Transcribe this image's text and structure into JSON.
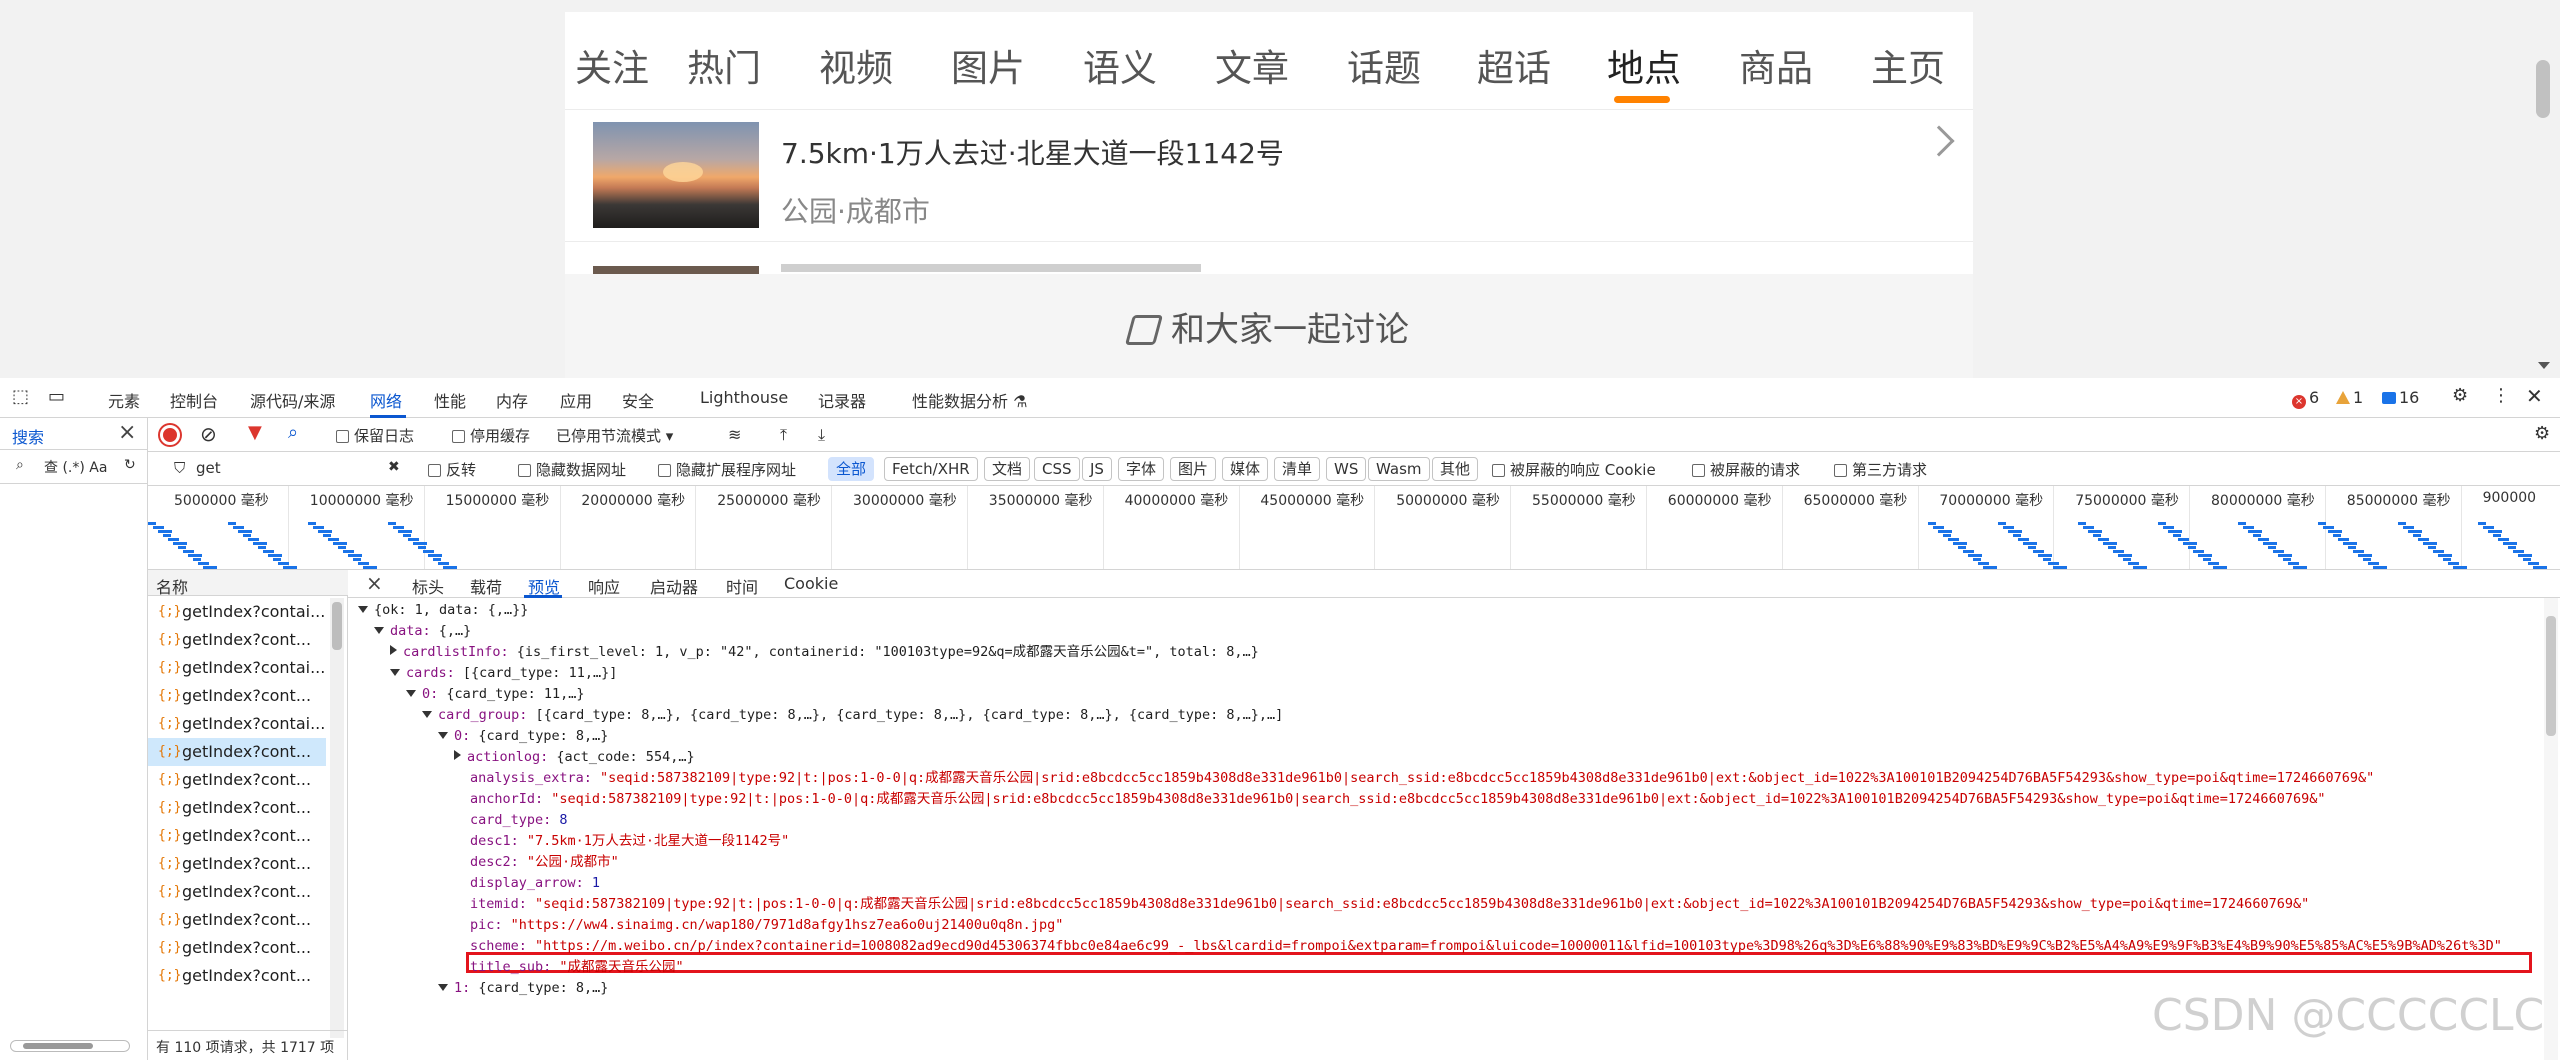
{
  "weibo": {
    "tabs": [
      "关注",
      "热门",
      "视频",
      "图片",
      "语义",
      "文章",
      "话题",
      "超话",
      "地点",
      "商品",
      "主页"
    ],
    "tab_partial": "关注",
    "active_tab": "地点",
    "poi": {
      "title": "7.5km·1万人去过·北星大道一段1142号",
      "subtitle": "公园·成都市"
    },
    "discuss": "和大家一起讨论"
  },
  "devtools": {
    "tabs": [
      "元素",
      "控制台",
      "源代码/来源",
      "网络",
      "性能",
      "内存",
      "应用",
      "安全",
      "Lighthouse",
      "记录器",
      "性能数据分析 ⚗"
    ],
    "active_tab": "网络",
    "badges": {
      "errors": "6",
      "warnings": "1",
      "messages": "16"
    },
    "search_panel": {
      "label": "搜索",
      "search_options": "查 (.*) Aa"
    },
    "toolbar1": {
      "preserve_log": "保留日志",
      "disable_cache": "停用缓存",
      "throttle": "已停用节流模式"
    },
    "toolbar2": {
      "filter_value": "get",
      "invert": "反转",
      "hide_data_urls": "隐藏数据网址",
      "hide_extension_urls": "隐藏扩展程序网址",
      "filters": [
        "全部",
        "Fetch/XHR",
        "文档",
        "CSS",
        "JS",
        "字体",
        "图片",
        "媒体",
        "清单",
        "WS",
        "Wasm",
        "其他"
      ],
      "active_filter": "全部",
      "blocked_cookies": "被屏蔽的响应 Cookie",
      "blocked_requests": "被屏蔽的请求",
      "third_party": "第三方请求"
    },
    "timeline_labels": [
      "5000000 毫秒",
      "10000000 毫秒",
      "15000000 毫秒",
      "20000000 毫秒",
      "25000000 毫秒",
      "30000000 毫秒",
      "35000000 毫秒",
      "40000000 毫秒",
      "45000000 毫秒",
      "50000000 毫秒",
      "55000000 毫秒",
      "60000000 毫秒",
      "65000000 毫秒",
      "70000000 毫秒",
      "75000000 毫秒",
      "80000000 毫秒",
      "85000000 毫秒",
      "900000"
    ],
    "name_header": "名称",
    "requests": [
      "getIndex?contai...",
      "getIndex?cont...",
      "getIndex?contai...",
      "getIndex?cont...",
      "getIndex?contai...",
      "getIndex?cont...",
      "getIndex?cont...",
      "getIndex?cont...",
      "getIndex?cont...",
      "getIndex?cont...",
      "getIndex?cont...",
      "getIndex?cont...",
      "getIndex?cont...",
      "getIndex?cont..."
    ],
    "status_line": "有 110 项请求，共 1717 项",
    "detail_tabs": [
      "标头",
      "载荷",
      "预览",
      "响应",
      "启动器",
      "时间",
      "Cookie"
    ],
    "active_detail_tab": "预览",
    "json_lines": [
      "{ok: 1, data: {,…}}",
      "data: {,…}",
      "cardlistInfo: {is_first_level: 1, v_p: \"42\", containerid: \"100103type=92&q=成都露天音乐公园&t=\", total: 8,…}",
      "cards: [{card_type: 11,…}]",
      "0: {card_type: 11,…}",
      "card_group: [{card_type: 8,…}, {card_type: 8,…}, {card_type: 8,…}, {card_type: 8,…}, {card_type: 8,…},…]",
      "0: {card_type: 8,…}",
      "actionlog: {act_code: 554,…}",
      "analysis_extra: \"seqid:587382109|type:92|t:|pos:1-0-0|q:成都露天音乐公园|srid:e8bcdcc5cc1859b4308d8e331de961b0|search_ssid:e8bcdcc5cc1859b4308d8e331de961b0|ext:&object_id=1022%3A100101B2094254D76BA5F54293&show_type=poi&qtime=1724660769&\"",
      "anchorId: \"seqid:587382109|type:92|t:|pos:1-0-0|q:成都露天音乐公园|srid:e8bcdcc5cc1859b4308d8e331de961b0|search_ssid:e8bcdcc5cc1859b4308d8e331de961b0|ext:&object_id=1022%3A100101B2094254D76BA5F54293&show_type=poi&qtime=1724660769&\"",
      "card_type: 8",
      "desc1: \"7.5km·1万人去过·北星大道一段1142号\"",
      "desc2: \"公园·成都市\"",
      "display_arrow: 1",
      "itemid: \"seqid:587382109|type:92|t:|pos:1-0-0|q:成都露天音乐公园|srid:e8bcdcc5cc1859b4308d8e331de961b0|search_ssid:e8bcdcc5cc1859b4308d8e331de961b0|ext:&object_id=1022%3A100101B2094254D76BA5F54293&show_type=poi&qtime=1724660769&\"",
      "pic: \"https://ww4.sinaimg.cn/wap180/7971d8afgy1hsz7ea6o0uj21400u0q8n.jpg\"",
      "scheme: \"https://m.weibo.cn/p/index?containerid=1008082ad9ecd90d45306374fbbc0e84ae6c99_-_lbs&lcardid=frompoi&extparam=frompoi&luicode=10000011&lfid=100103type%3D98%26q%3D%E6%88%90%E9%83%BD%E9%9C%B2%E5%A4%A9%E9%9F%B3%E4%B9%90%E5%85%AC%E5%9B%AD%26t%3D\"",
      "title_sub: \"成都露天音乐公园\"",
      "1: {card_type: 8,…}"
    ],
    "watermark": "CSDN @CCCCCLC"
  }
}
